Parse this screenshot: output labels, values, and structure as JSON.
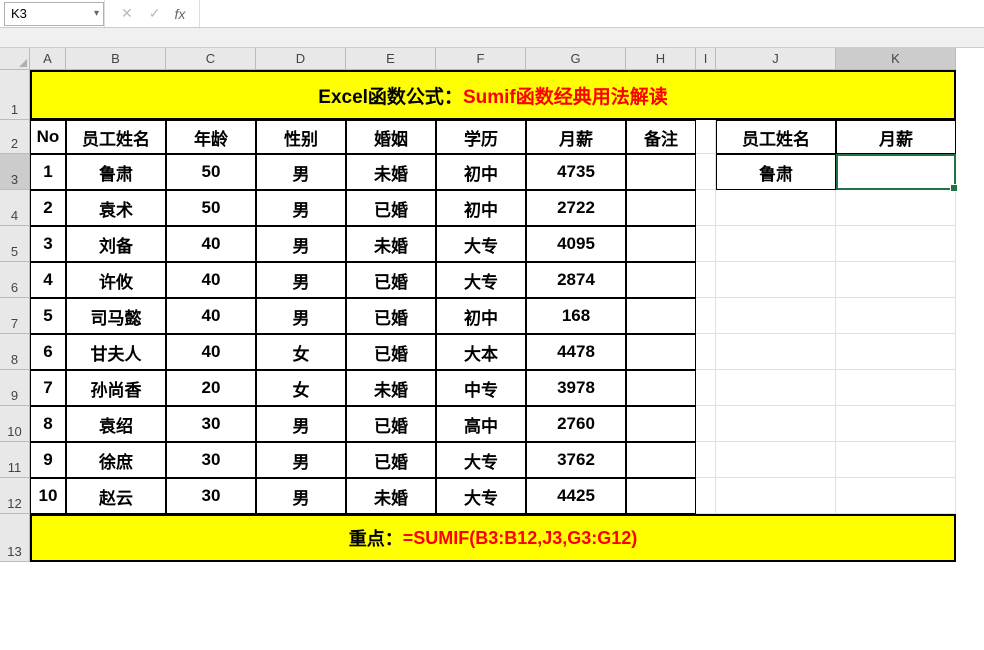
{
  "nameBox": "K3",
  "formulaBarValue": "",
  "columns": [
    "A",
    "B",
    "C",
    "D",
    "E",
    "F",
    "G",
    "H",
    "I",
    "J",
    "K"
  ],
  "rowNumbers": [
    1,
    2,
    3,
    4,
    5,
    6,
    7,
    8,
    9,
    10,
    11,
    12,
    13
  ],
  "title": {
    "prefix": "Excel函数公式：",
    "suffix": "Sumif函数经典用法解读"
  },
  "headers": {
    "no": "No",
    "name": "员工姓名",
    "age": "年龄",
    "gender": "性别",
    "marriage": "婚姻",
    "education": "学历",
    "salary": "月薪",
    "remark": "备注"
  },
  "lookupHeaders": {
    "name": "员工姓名",
    "salary": "月薪"
  },
  "data": [
    {
      "no": "1",
      "name": "鲁肃",
      "age": "50",
      "gender": "男",
      "marriage": "未婚",
      "education": "初中",
      "salary": "4735",
      "remark": ""
    },
    {
      "no": "2",
      "name": "袁术",
      "age": "50",
      "gender": "男",
      "marriage": "已婚",
      "education": "初中",
      "salary": "2722",
      "remark": ""
    },
    {
      "no": "3",
      "name": "刘备",
      "age": "40",
      "gender": "男",
      "marriage": "未婚",
      "education": "大专",
      "salary": "4095",
      "remark": ""
    },
    {
      "no": "4",
      "name": "许攸",
      "age": "40",
      "gender": "男",
      "marriage": "已婚",
      "education": "大专",
      "salary": "2874",
      "remark": ""
    },
    {
      "no": "5",
      "name": "司马懿",
      "age": "40",
      "gender": "男",
      "marriage": "已婚",
      "education": "初中",
      "salary": "168",
      "remark": ""
    },
    {
      "no": "6",
      "name": "甘夫人",
      "age": "40",
      "gender": "女",
      "marriage": "已婚",
      "education": "大本",
      "salary": "4478",
      "remark": ""
    },
    {
      "no": "7",
      "name": "孙尚香",
      "age": "20",
      "gender": "女",
      "marriage": "未婚",
      "education": "中专",
      "salary": "3978",
      "remark": ""
    },
    {
      "no": "8",
      "name": "袁绍",
      "age": "30",
      "gender": "男",
      "marriage": "已婚",
      "education": "高中",
      "salary": "2760",
      "remark": ""
    },
    {
      "no": "9",
      "name": "徐庶",
      "age": "30",
      "gender": "男",
      "marriage": "已婚",
      "education": "大专",
      "salary": "3762",
      "remark": ""
    },
    {
      "no": "10",
      "name": "赵云",
      "age": "30",
      "gender": "男",
      "marriage": "未婚",
      "education": "大专",
      "salary": "4425",
      "remark": ""
    }
  ],
  "lookupData": {
    "name": "鲁肃",
    "salary": ""
  },
  "footer": {
    "prefix": "重点：",
    "formula": "=SUMIF(B3:B12,J3,G3:G12)"
  },
  "selectedCell": "K3",
  "selectedColumn": "K",
  "selectedRow": 3,
  "icons": {
    "cancel": "✕",
    "confirm": "✓",
    "fx": "fx",
    "dropdown": "▾"
  }
}
